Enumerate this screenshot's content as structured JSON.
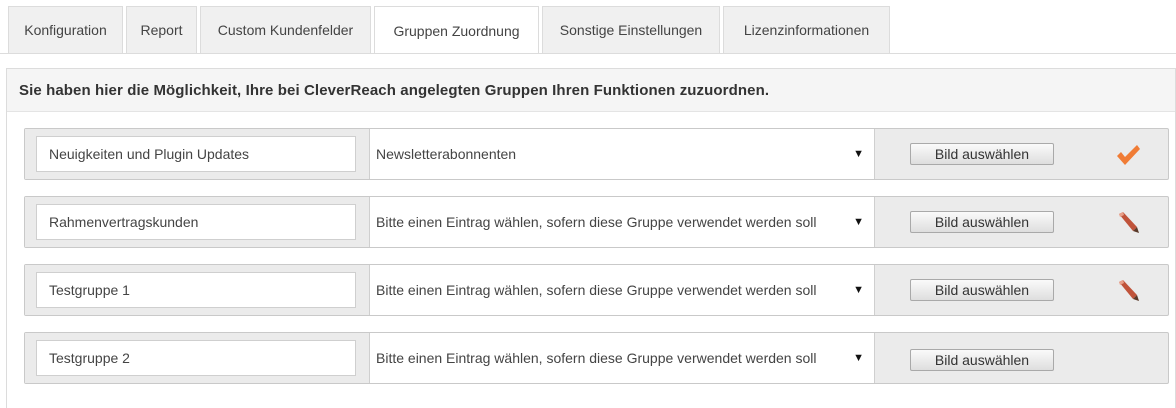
{
  "tabs": [
    {
      "label": "Konfiguration",
      "active": false
    },
    {
      "label": "Report",
      "active": false
    },
    {
      "label": "Custom Kundenfelder",
      "active": false
    },
    {
      "label": "Gruppen Zuordnung",
      "active": true
    },
    {
      "label": "Sonstige Einstellungen",
      "active": false
    },
    {
      "label": "Lizenzinformationen",
      "active": false
    }
  ],
  "panel": {
    "heading": "Sie haben hier die Möglichkeit, Ihre bei CleverReach angelegten Gruppen Ihren Funktionen zuzuordnen."
  },
  "groups": [
    {
      "name": "Neuigkeiten und Plugin Updates",
      "function": "Newsletterabonnenten",
      "image_button": "Bild auswählen",
      "status_icon": "checkmark-icon"
    },
    {
      "name": "Rahmenvertragskunden",
      "function": "Bitte einen Eintrag wählen, sofern diese Gruppe verwendet werden soll",
      "image_button": "Bild auswählen",
      "status_icon": "pencil-icon"
    },
    {
      "name": "Testgruppe 1",
      "function": "Bitte einen Eintrag wählen, sofern diese Gruppe verwendet werden soll",
      "image_button": "Bild auswählen",
      "status_icon": "pencil-icon"
    },
    {
      "name": "Testgruppe 2",
      "function": "Bitte einen Eintrag wählen, sofern diese Gruppe verwendet werden soll",
      "image_button": "Bild auswählen",
      "status_icon": "none"
    }
  ],
  "colors": {
    "checkmark": "#f07c35",
    "pencil": "#c0533a"
  }
}
